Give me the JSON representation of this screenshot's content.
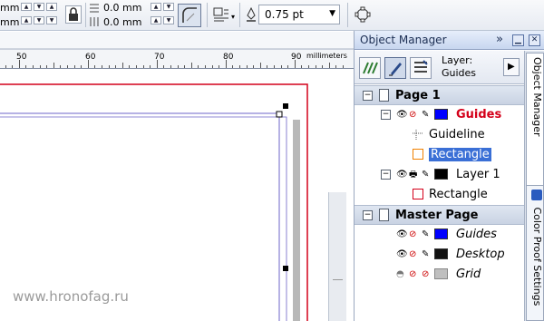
{
  "property_bar": {
    "pos_partial_1": "mm",
    "pos_partial_2": "mm",
    "offset_x": "0.0 mm",
    "offset_y": "0.0 mm",
    "outline_width": "0.75 pt"
  },
  "ruler": {
    "unit": "millimeters",
    "labels": [
      "50",
      "60",
      "70",
      "80",
      "90"
    ]
  },
  "object_manager": {
    "title": "Object Manager",
    "layer_label": "Layer:",
    "layer_name": "Guides",
    "tree": [
      {
        "kind": "page",
        "label": "Page 1"
      },
      {
        "kind": "layer",
        "label": "Guides",
        "color": "#0000ff",
        "label_color": "#d4001a"
      },
      {
        "kind": "object",
        "label": "Guideline"
      },
      {
        "kind": "object",
        "label": "Rectangle",
        "selected": true,
        "icon_color": "#f08000"
      },
      {
        "kind": "layer",
        "label": "Layer 1",
        "color": "#000000",
        "label_color": "#000000"
      },
      {
        "kind": "object",
        "label": "Rectangle",
        "icon_color": "#d4001a"
      },
      {
        "kind": "page",
        "label": "Master Page"
      },
      {
        "kind": "master-layer",
        "label": "Guides",
        "color": "#0000ff"
      },
      {
        "kind": "master-layer",
        "label": "Desktop",
        "color": "#111111"
      },
      {
        "kind": "master-layer",
        "label": "Grid",
        "color": "#bfbfbf"
      }
    ]
  },
  "side_tabs": [
    "Object Manager",
    "Color Proof Settings"
  ],
  "watermark": "www.hronofag.ru",
  "colors": {
    "page_border": "#d4001a",
    "selection": "#3a6fd6",
    "guide": "#6e64c8"
  }
}
